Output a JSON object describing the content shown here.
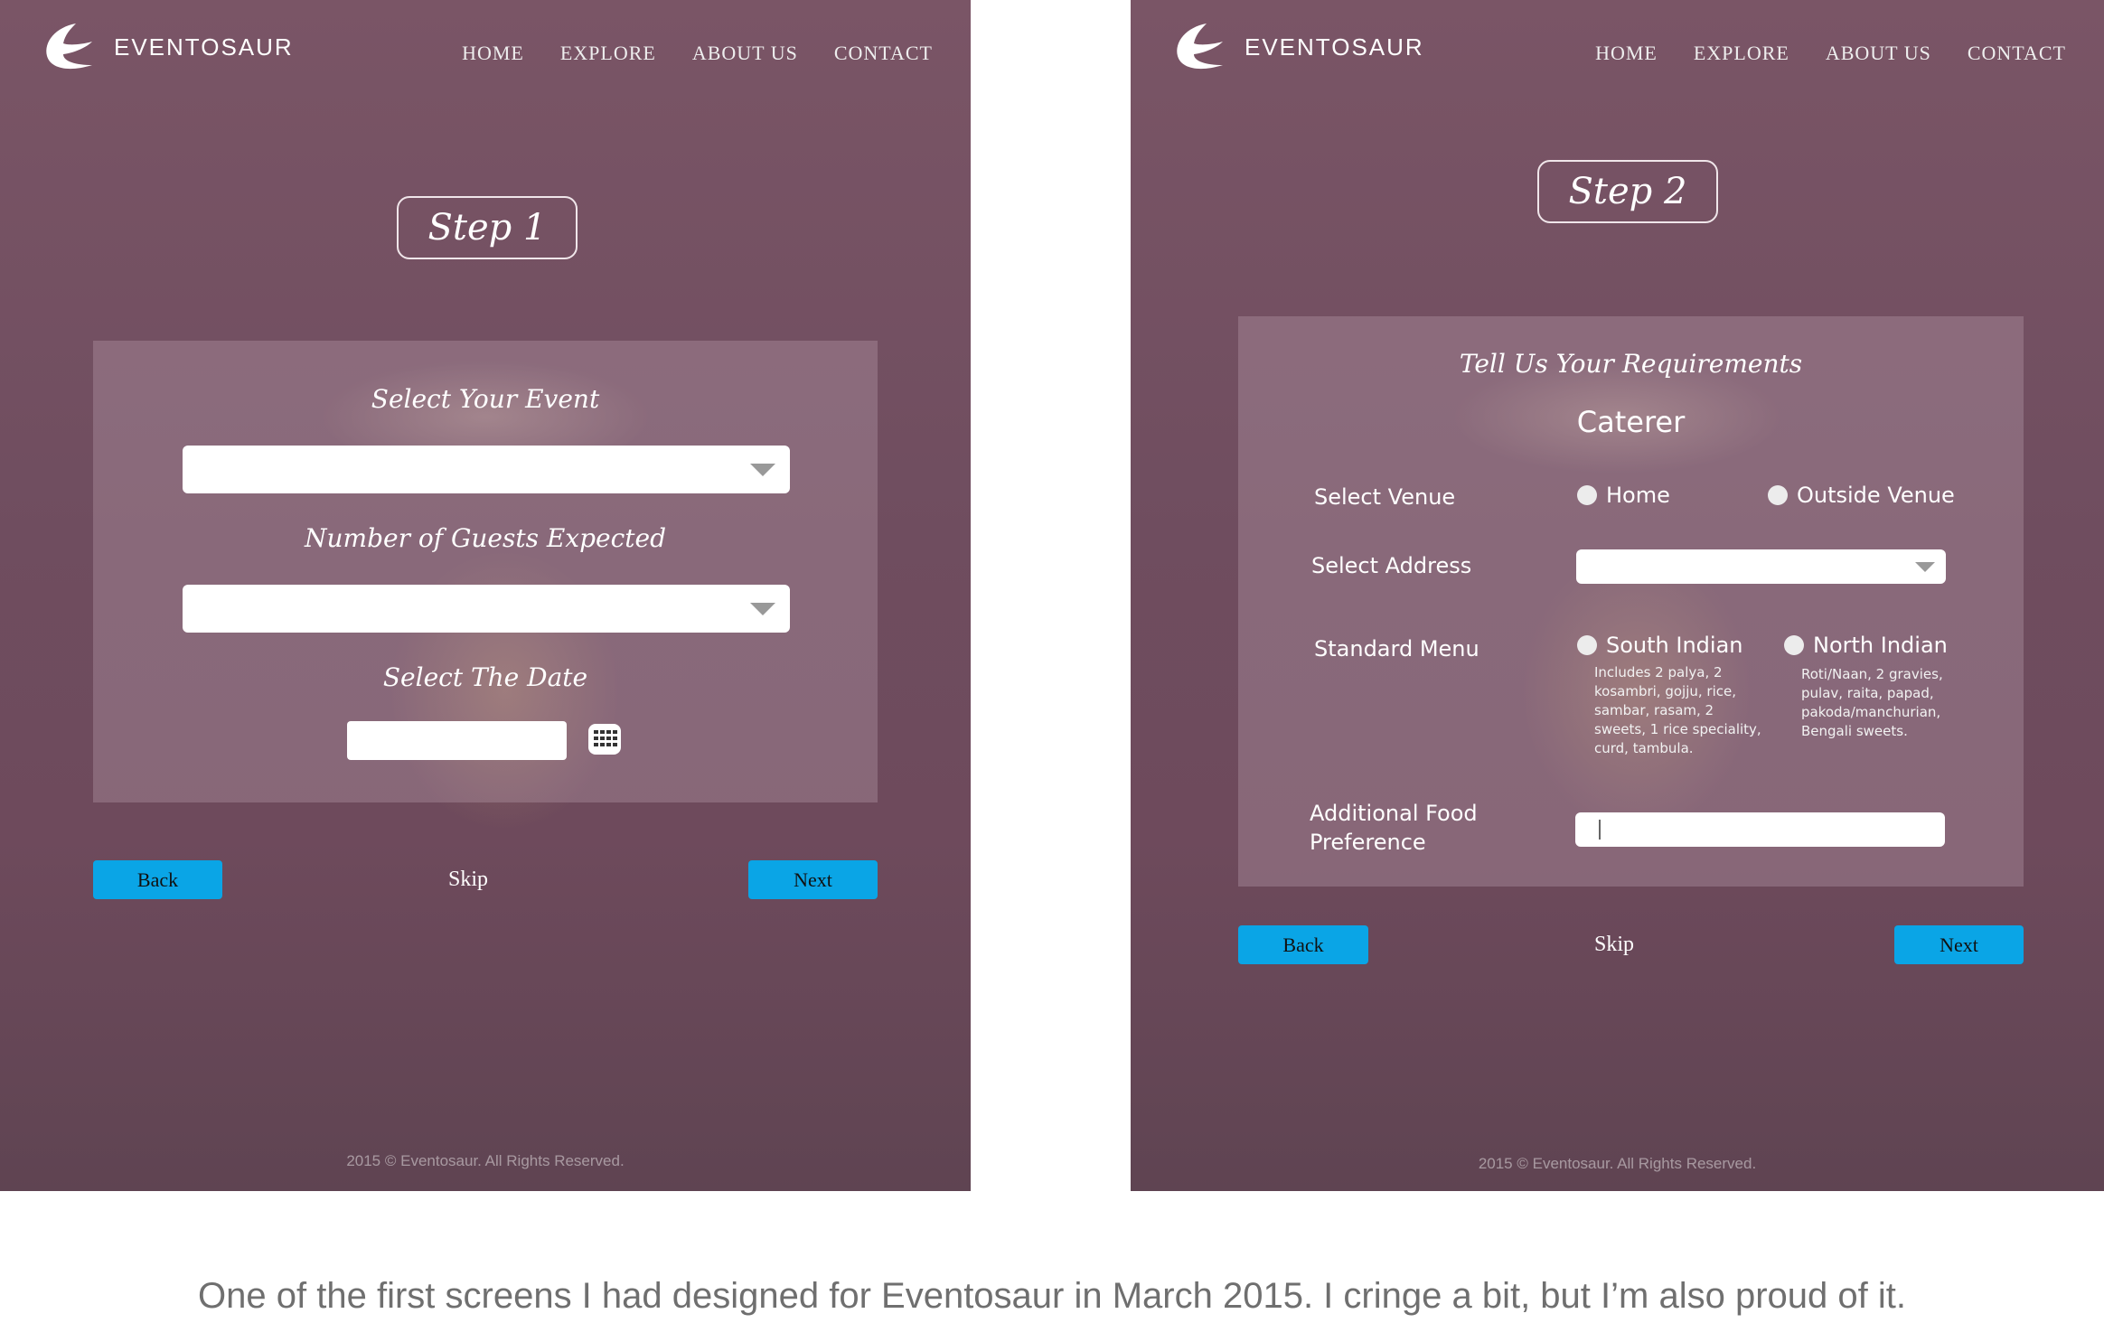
{
  "brand": {
    "name": "EVENTOSAUR"
  },
  "nav": {
    "home": "HOME",
    "explore": "EXPLORE",
    "about": "ABOUT US",
    "contact": "CONTACT"
  },
  "step1": {
    "step_label": "Step 1",
    "select_event_label": "Select Your Event",
    "select_event_value": "",
    "guests_label": "Number of Guests Expected",
    "guests_value": "",
    "date_label": "Select The Date",
    "date_value": "",
    "date_icon": "calendar-icon"
  },
  "step2": {
    "step_label": "Step 2",
    "heading": "Tell Us Your Requirements",
    "service": "Caterer",
    "venue_label": "Select Venue",
    "venue_options": [
      "Home",
      "Outside Venue"
    ],
    "address_label": "Select Address",
    "address_value": "",
    "menu_label": "Standard Menu",
    "menu_options": [
      {
        "name": "South Indian",
        "lines": [
          "Includes 2 palya, 2",
          "kosambri, gojju, rice,",
          "sambar, rasam, 2",
          "sweets, 1 rice speciality,",
          "curd, tambula."
        ]
      },
      {
        "name": "North Indian",
        "lines": [
          "Roti/Naan, 2 gravies,",
          "pulav, raita, papad,",
          "pakoda/manchurian,",
          "Bengali sweets."
        ]
      }
    ],
    "additional_label_line1": "Additional Food",
    "additional_label_line2": "Preference",
    "additional_value": ""
  },
  "buttons": {
    "back": "Back",
    "skip": "Skip",
    "next": "Next"
  },
  "footer": "2015 © Eventosaur. All Rights Reserved.",
  "caption": "One of the first screens I had designed for Eventosaur in March 2015. I cringe a bit, but I’m also proud of it.",
  "colors": {
    "accent": "#0aa5e6",
    "overlay": "#6e4a5c"
  }
}
